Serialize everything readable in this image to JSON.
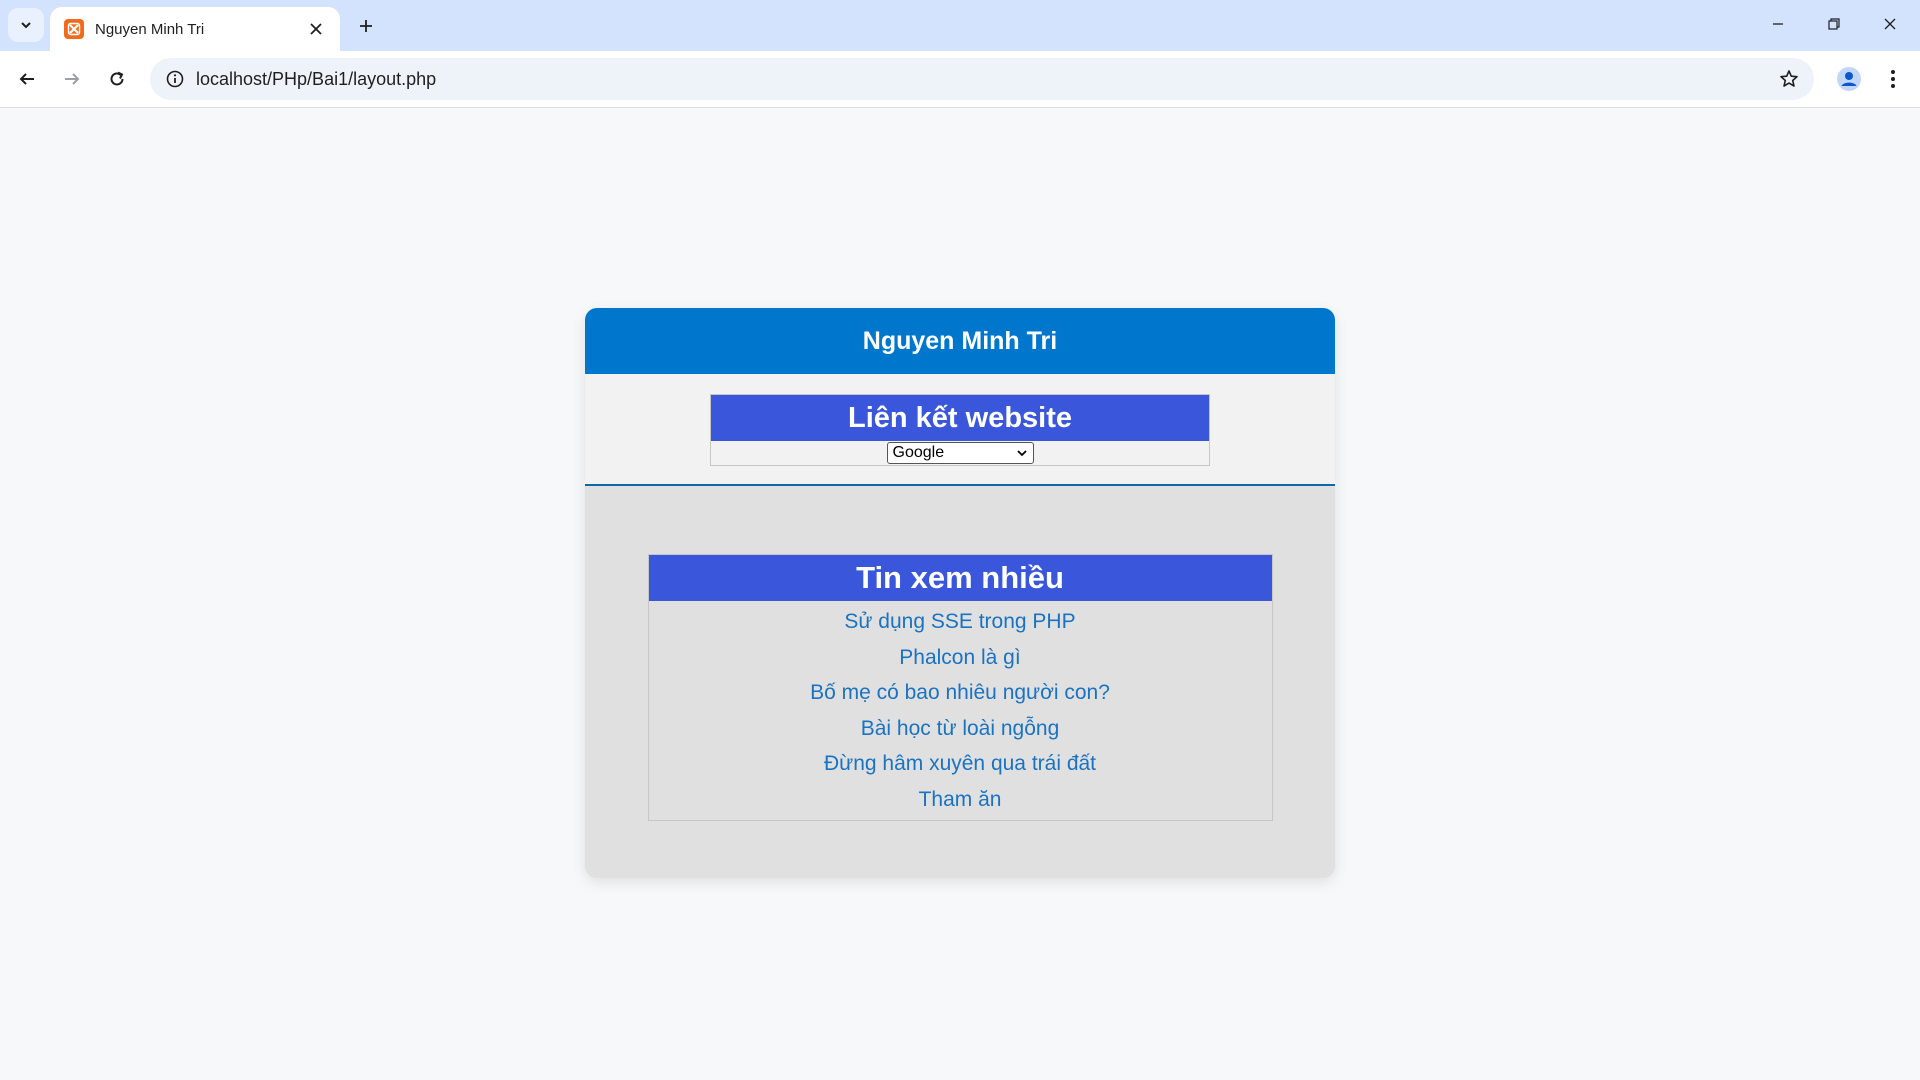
{
  "browser": {
    "tab_title": "Nguyen Minh Tri",
    "url": "localhost/PHp/Bai1/layout.php"
  },
  "page": {
    "header_title": "Nguyen Minh Tri",
    "links_box": {
      "title": "Liên kết website",
      "select_value": "Google"
    },
    "news_box": {
      "title": "Tin xem nhiều",
      "items": [
        "Sử dụng SSE trong PHP",
        "Phalcon là gì",
        "Bố mẹ có bao nhiêu người con?",
        "Bài học từ loài ngỗng",
        "Đừng hâm xuyên qua trái đất",
        "Tham ăn"
      ]
    }
  },
  "colors": {
    "header_bg": "#0077cc",
    "box_title_bg": "#3a56db",
    "link_color": "#1a73c2",
    "tabstrip_bg": "#d3e3fd"
  }
}
